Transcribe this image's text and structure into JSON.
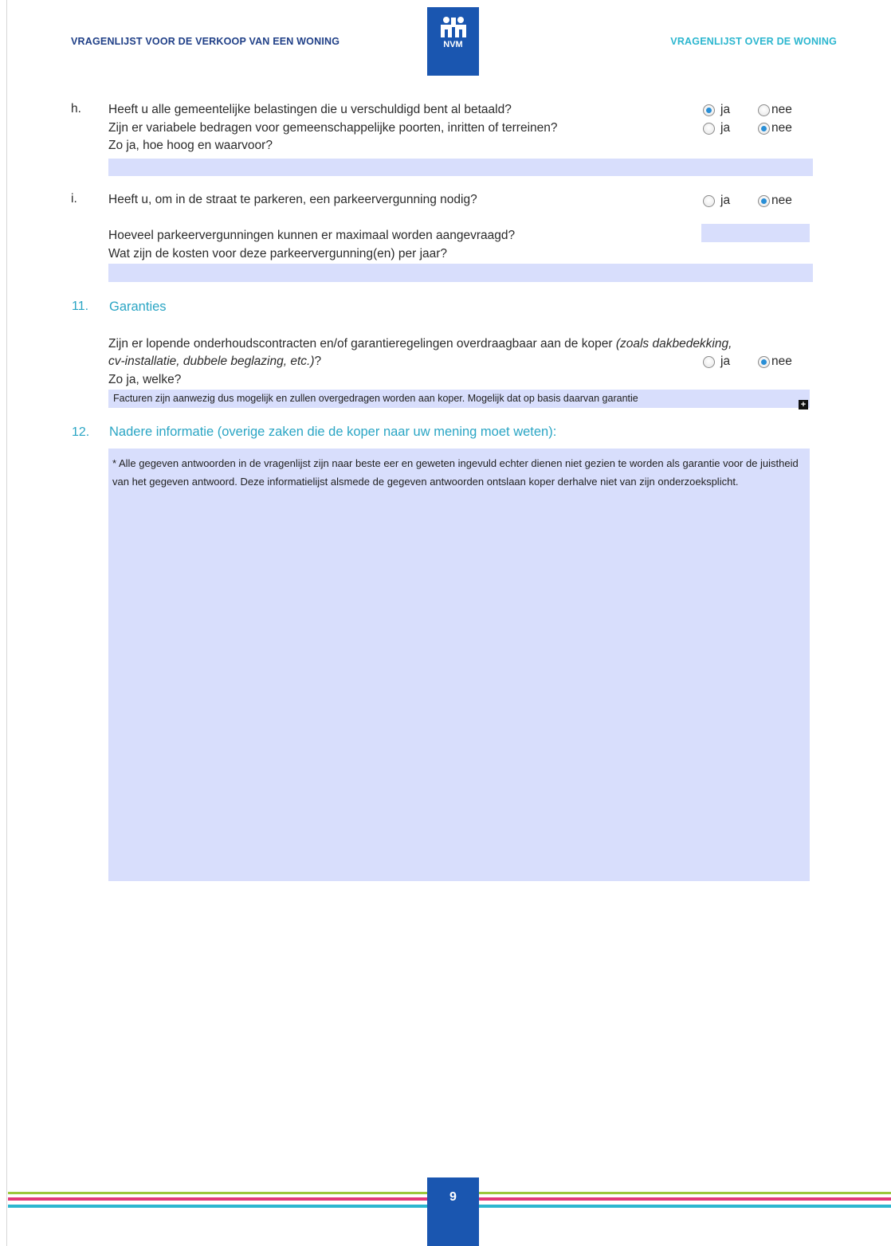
{
  "header": {
    "left_title": "VRAGENLIJST VOOR DE VERKOOP VAN EEN WONING",
    "right_title": "VRAGENLIJST OVER DE WONING",
    "logo_text": "NVM"
  },
  "section_h": {
    "letter": "h.",
    "q1": "Heeft u alle gemeentelijke belastingen die u verschuldigd bent al betaald?",
    "q1_ja": "ja",
    "q1_nee": "nee",
    "q1_selected": "ja",
    "q2": "Zijn er variabele bedragen voor gemeenschappelijke poorten, inritten of terreinen?",
    "q2_ja": "ja",
    "q2_nee": "nee",
    "q2_selected": "nee",
    "q3": "Zo ja, hoe hoog en waarvoor?",
    "answer": ""
  },
  "section_i": {
    "letter": "i.",
    "q1": "Heeft u, om in de straat te parkeren, een parkeervergunning nodig?",
    "q1_ja": "ja",
    "q1_nee": "nee",
    "q1_selected": "nee",
    "q2": "Hoeveel parkeervergunningen kunnen er maximaal worden aangevraagd?",
    "q2_answer": "",
    "q3": "Wat zijn de kosten voor deze parkeervergunning(en) per jaar?",
    "q3_answer": ""
  },
  "section_11": {
    "number": "11.",
    "title": "Garanties",
    "q_line1_normal": "Zijn er lopende onderhoudscontracten en/of garantieregelingen overdraagbaar aan de koper ",
    "q_line1_italic": "(zoals dakbedekking,",
    "q_line2_italic": "cv-installatie, dubbele beglazing, etc.)",
    "q_line2_normal": "?",
    "ja": "ja",
    "nee": "nee",
    "selected": "nee",
    "q2": "Zo ja, welke?",
    "answer": "Facturen zijn aanwezig dus mogelijk en zullen overgedragen worden aan koper. Mogelijk dat op basis daarvan garantie",
    "expand_symbol": "+"
  },
  "section_12": {
    "number": "12.",
    "title": "Nadere informatie (overige zaken die de koper naar uw mening moet weten):",
    "answer": "* Alle gegeven antwoorden in de vragenlijst zijn naar beste eer en geweten ingevuld echter dienen niet gezien te worden als garantie voor de juistheid van het gegeven antwoord. Deze informatielijst alsmede de gegeven antwoorden ontslaan koper derhalve niet van zijn onderzoeksplicht."
  },
  "footer": {
    "page_number": "9",
    "stripe_colors": [
      "#9bc83c",
      "#e23a78",
      "#2bb6cf"
    ]
  },
  "colors": {
    "field_bg": "#d8defc",
    "accent_blue": "#1a56b0",
    "section_cyan": "#2aa5c4",
    "header_navy": "#1f3f87"
  }
}
